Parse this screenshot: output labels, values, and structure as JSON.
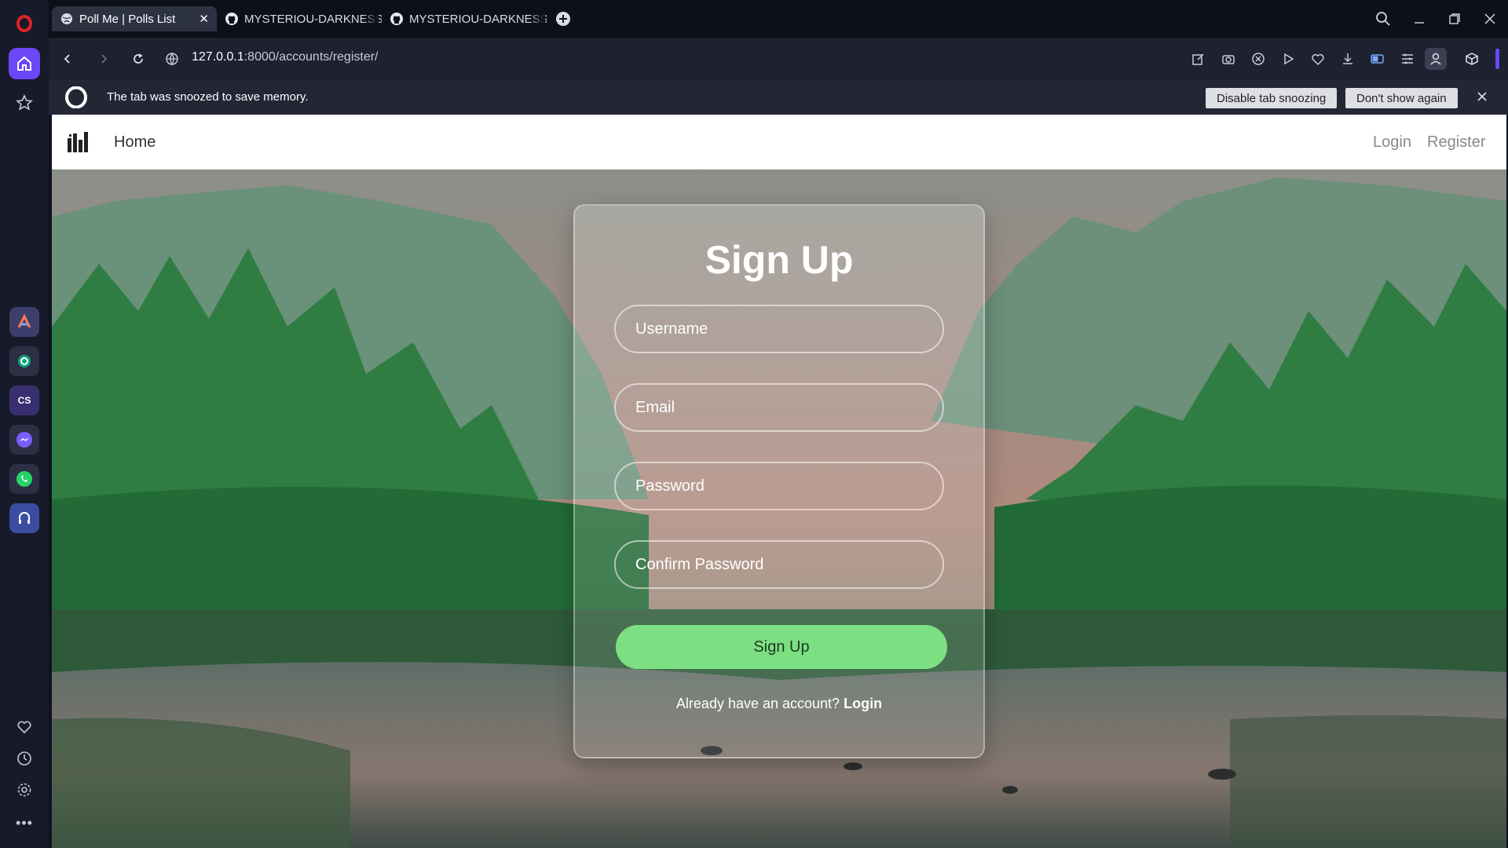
{
  "browser": {
    "tabs": [
      {
        "title": "Poll Me | Polls List",
        "active": true,
        "icon": "globe-icon"
      },
      {
        "title": "MYSTERIOU-DARKNESS/V",
        "active": false,
        "icon": "github-icon"
      },
      {
        "title": "MYSTERIOU-DARKNESS/V",
        "active": false,
        "icon": "github-icon"
      }
    ],
    "url_host": "127.0.0.1",
    "url_path": ":8000/accounts/register/",
    "snooze": {
      "message": "The tab was snoozed to save memory.",
      "disable_label": "Disable tab snoozing",
      "dont_show_label": "Don't show again"
    },
    "accent_color": "#6b47f5"
  },
  "site": {
    "nav": {
      "home": "Home",
      "login": "Login",
      "register": "Register"
    },
    "form": {
      "title": "Sign Up",
      "username_placeholder": "Username",
      "email_placeholder": "Email",
      "password_placeholder": "Password",
      "confirm_placeholder": "Confirm Password",
      "submit_label": "Sign Up",
      "already_text": "Already have an account? ",
      "login_link": "Login"
    },
    "button_color": "#7ce082"
  }
}
